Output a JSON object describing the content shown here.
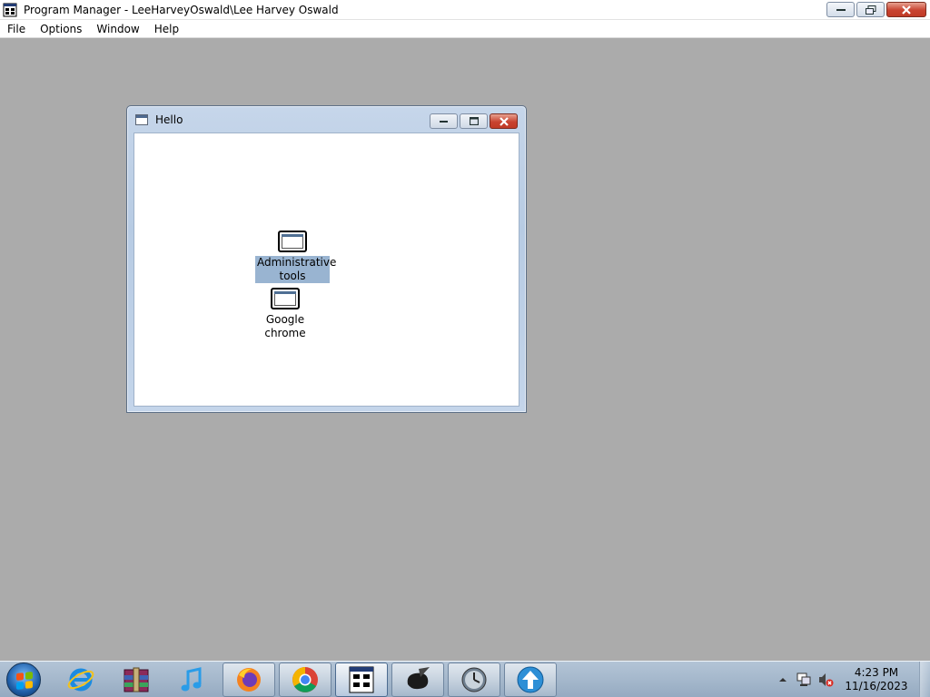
{
  "window": {
    "title": "Program Manager - LeeHarveyOswald\\Lee Harvey Oswald"
  },
  "menu": {
    "items": [
      "File",
      "Options",
      "Window",
      "Help"
    ]
  },
  "group_window": {
    "title": "Hello",
    "items": [
      {
        "label": "Administrative tools",
        "selected": true
      },
      {
        "label": "Google chrome",
        "selected": false
      }
    ]
  },
  "taskbar": {
    "buttons": [
      {
        "name": "internet-explorer-icon",
        "state": "pinned"
      },
      {
        "name": "winrar-icon",
        "state": "pinned"
      },
      {
        "name": "itunes-icon",
        "state": "pinned"
      },
      {
        "name": "firefox-icon",
        "state": "running"
      },
      {
        "name": "chrome-icon",
        "state": "running"
      },
      {
        "name": "program-manager-icon",
        "state": "active"
      },
      {
        "name": "paint-icon",
        "state": "running"
      },
      {
        "name": "clock-globe-icon",
        "state": "running"
      },
      {
        "name": "upload-arrow-icon",
        "state": "running"
      }
    ],
    "clock": {
      "time": "4:23 PM",
      "date": "11/16/2023"
    }
  },
  "colors": {
    "desktop": "#ababab",
    "selection": "#99b4d1",
    "close_button": "#c84330"
  }
}
